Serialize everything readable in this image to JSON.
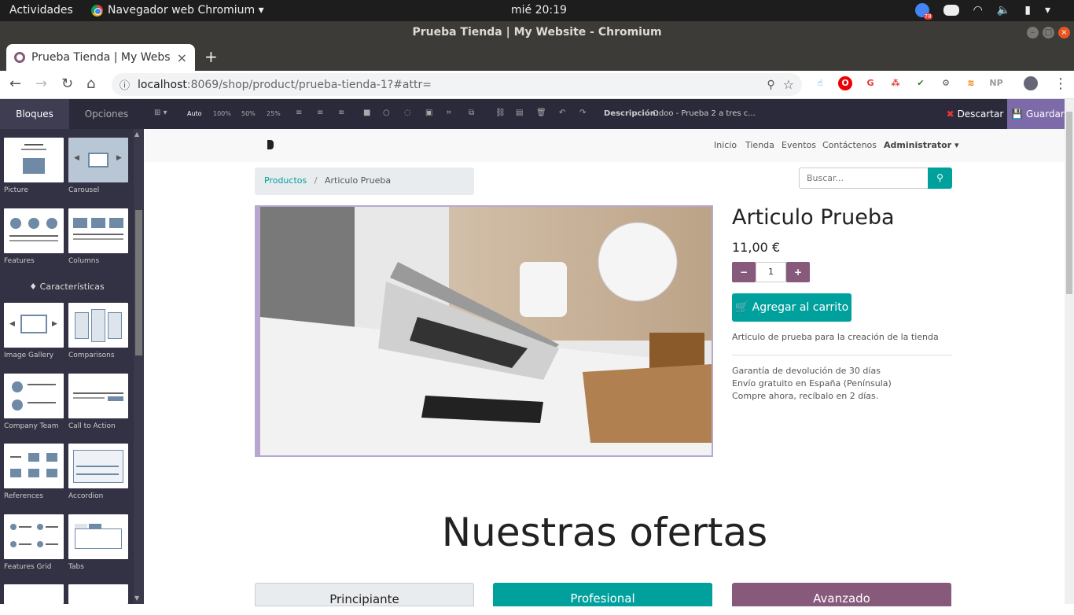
{
  "topbar": {
    "activities": "Actividades",
    "app": "Navegador web Chromium ▾",
    "clock": "mié 20:19",
    "badge": "78"
  },
  "window": {
    "title": "Prueba Tienda | My Website - Chromium"
  },
  "tab": {
    "title": "Prueba Tienda | My Websi",
    "close": "×",
    "new": "+"
  },
  "address": {
    "host": "localhost",
    "path": ":8069/shop/product/prueba-tienda-1?#attr="
  },
  "editor": {
    "tab_blocks": "Bloques",
    "tab_options": "Opciones",
    "sizes": [
      "Auto",
      "100%",
      "50%",
      "25%"
    ],
    "desc_label": "Descripción:",
    "desc_value": "Odoo - Prueba 2 a tres c...",
    "discard": "Descartar",
    "save": "Guardar"
  },
  "panel": {
    "snippets": [
      "Picture",
      "Carousel",
      "Features",
      "Columns",
      "Image Gallery",
      "Comparisons",
      "Company Team",
      "Call to Action",
      "References",
      "Accordion",
      "Features Grid",
      "Tabs"
    ],
    "section": "Características"
  },
  "site": {
    "nav": [
      "Inicio",
      "Tienda",
      "Eventos",
      "Contáctenos"
    ],
    "user": "Administrator ▾",
    "crumb_parent": "Productos",
    "crumb_sep": "/",
    "crumb_current": "Articulo Prueba",
    "search_placeholder": "Buscar...",
    "product_title": "Articulo Prueba",
    "price": "11,00 €",
    "qty": "1",
    "cart": "Agregar al carrito",
    "desc": "Articulo de prueba para la creación de la tienda",
    "guarantees": [
      "Garantía de devolución de 30 días",
      "Envío gratuito en España (Península)",
      "Compre ahora, recíbalo en 2 días."
    ],
    "offers_title": "Nuestras ofertas",
    "plans": [
      "Principiante",
      "Profesional",
      "Avanzado"
    ]
  },
  "colors": {
    "odoo_purple": "#875a7b",
    "teal": "#00a09d"
  }
}
